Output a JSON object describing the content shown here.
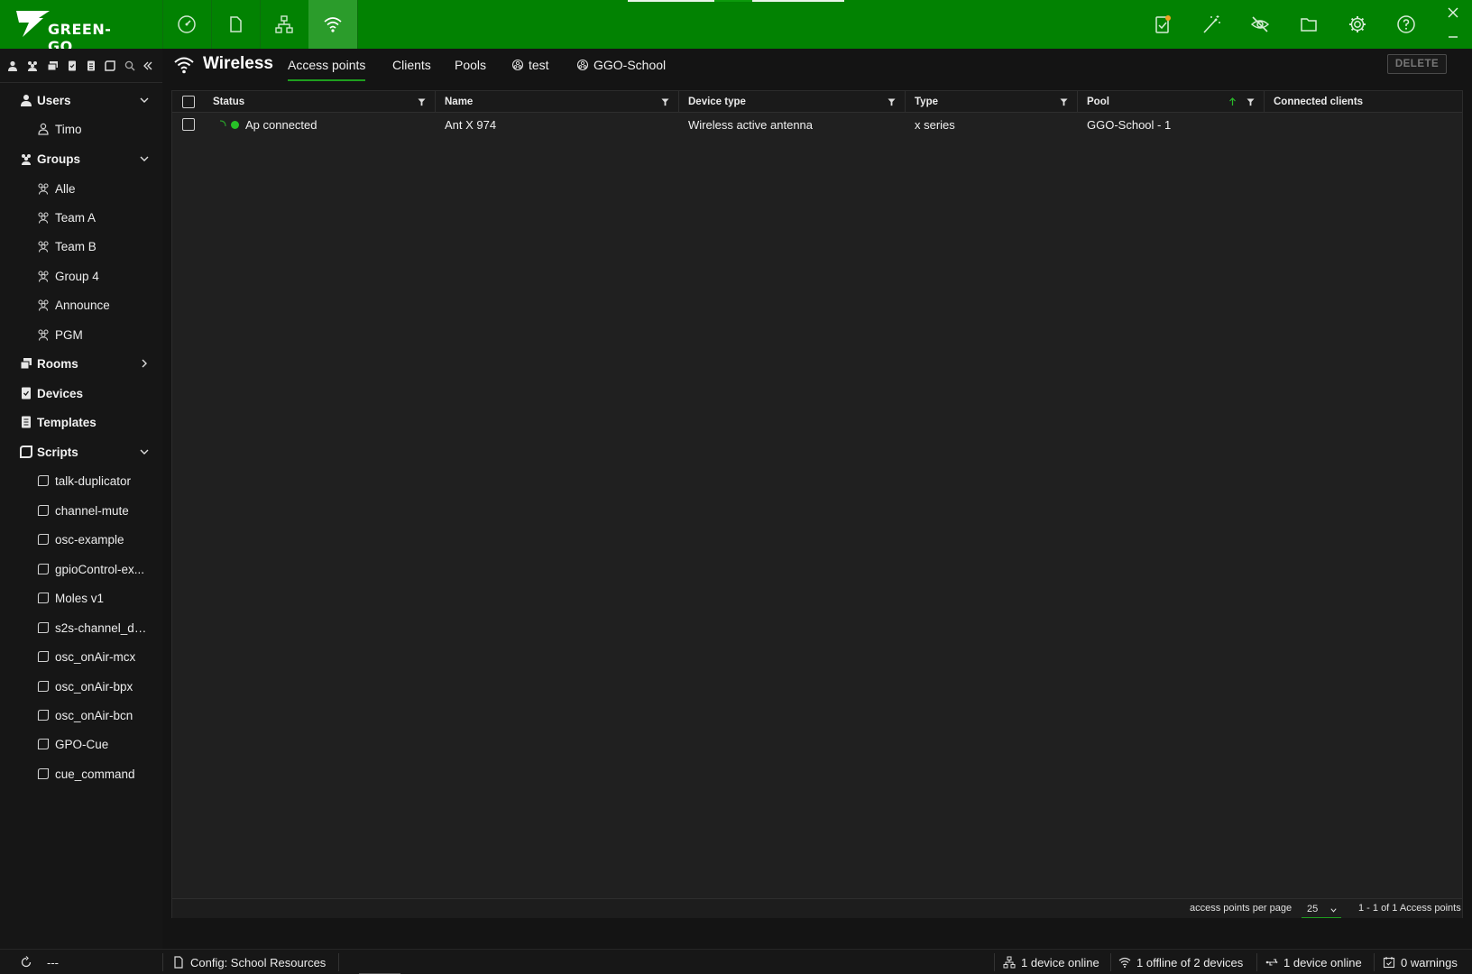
{
  "app": {
    "logo_text": "GREEN-GO"
  },
  "sidebar": {
    "sections": {
      "users": "Users",
      "groups": "Groups",
      "rooms": "Rooms",
      "devices": "Devices",
      "templates": "Templates",
      "scripts": "Scripts"
    },
    "users": [
      "Timo"
    ],
    "groups": [
      "Alle",
      "Team A",
      "Team B",
      "Group 4",
      "Announce",
      "PGM"
    ],
    "scripts": [
      "talk-duplicator",
      "channel-mute",
      "osc-example",
      "gpioControl-ex...",
      "Moles v1",
      "s2s-channel_du...",
      "osc_onAir-mcx",
      "osc_onAir-bpx",
      "osc_onAir-bcn",
      "GPO-Cue",
      "cue_command"
    ]
  },
  "main": {
    "title": "Wireless",
    "tabs": [
      "Access points",
      "Clients",
      "Pools",
      "test",
      "GGO-School"
    ],
    "delete_label": "DELETE"
  },
  "table": {
    "columns": [
      "Status",
      "Name",
      "Device type",
      "Type",
      "Pool",
      "Connected clients"
    ],
    "rows": [
      {
        "status": "Ap connected",
        "name": "Ant X 974",
        "device_type": "Wireless active antenna",
        "type": "x series",
        "pool": "GGO-School - 1",
        "connected_clients": ""
      }
    ],
    "footer": {
      "per_page_label": "access points per page",
      "per_page_value": "25",
      "range_label": "1 - 1 of 1 Access points"
    }
  },
  "statusbar": {
    "sync_text": "---",
    "config": "Config: School Resources",
    "devices_online": "1 device online",
    "wireless_status": "1 offline of 2 devices",
    "usb_status": "1 device online",
    "warnings": "0 warnings"
  },
  "colors": {
    "brand_green": "#028202",
    "active_nav": "#2b9c2b",
    "status_ok": "#27c027",
    "background": "#141414"
  }
}
